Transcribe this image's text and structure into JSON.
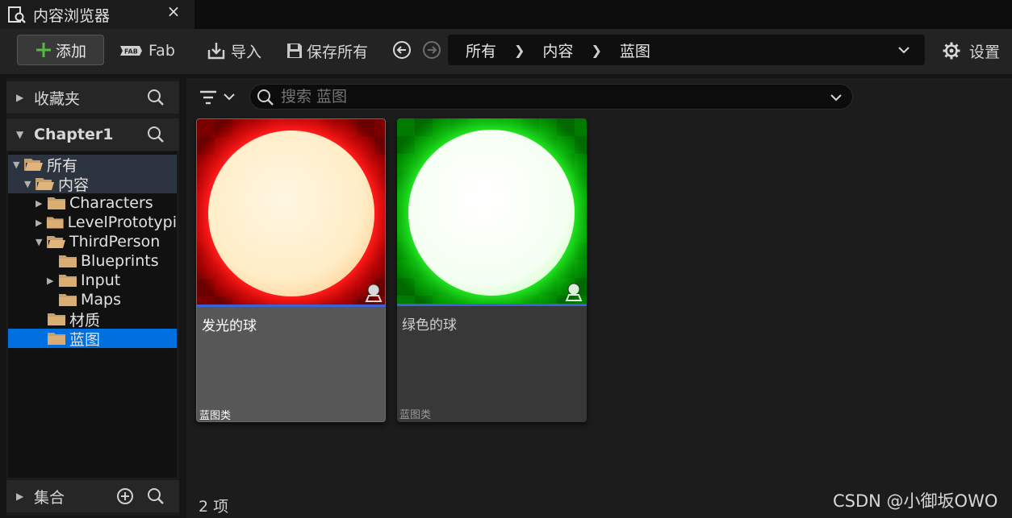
{
  "window": {
    "tab_title": "内容浏览器",
    "close_glyph": "×"
  },
  "toolbar": {
    "add_label": "添加",
    "fab_label": "Fab",
    "import_label": "导入",
    "save_all_label": "保存所有",
    "settings_label": "设置"
  },
  "breadcrumb": [
    "所有",
    "内容",
    "蓝图"
  ],
  "left_panel": {
    "favorites_label": "收藏夹",
    "project_label": "Chapter1",
    "collections_label": "集合",
    "tree": [
      {
        "label": "所有",
        "level": 0,
        "expanded": true,
        "selected": false
      },
      {
        "label": "内容",
        "level": 1,
        "expanded": true,
        "selected": false
      },
      {
        "label": "Characters",
        "level": 2,
        "expanded": false,
        "selected": false
      },
      {
        "label": "LevelPrototypi",
        "level": 2,
        "expanded": false,
        "selected": false
      },
      {
        "label": "ThirdPerson",
        "level": 2,
        "expanded": true,
        "selected": false
      },
      {
        "label": "Blueprints",
        "level": 3,
        "expanded": null,
        "selected": false
      },
      {
        "label": "Input",
        "level": 3,
        "expanded": false,
        "selected": false
      },
      {
        "label": "Maps",
        "level": 3,
        "expanded": null,
        "selected": false
      },
      {
        "label": "材质",
        "level": 2,
        "expanded": null,
        "selected": false
      },
      {
        "label": "蓝图",
        "level": 2,
        "expanded": null,
        "selected": true
      }
    ]
  },
  "search": {
    "placeholder": "搜索 蓝图"
  },
  "assets": [
    {
      "name": "发光的球",
      "type": "蓝图类",
      "glow_color": "#c40000",
      "sphere_color": "#fff3d6",
      "selected": true
    },
    {
      "name": "绿色的球",
      "type": "蓝图类",
      "glow_color": "#00b400",
      "sphere_color": "#f7fff4",
      "selected": false
    }
  ],
  "status": {
    "item_count": "2 项"
  },
  "watermark": "CSDN @小御坂OWO",
  "colors": {
    "selection": "#0070e0",
    "accent_stripe": "#3b63d6",
    "add_icon": "#57b946"
  }
}
